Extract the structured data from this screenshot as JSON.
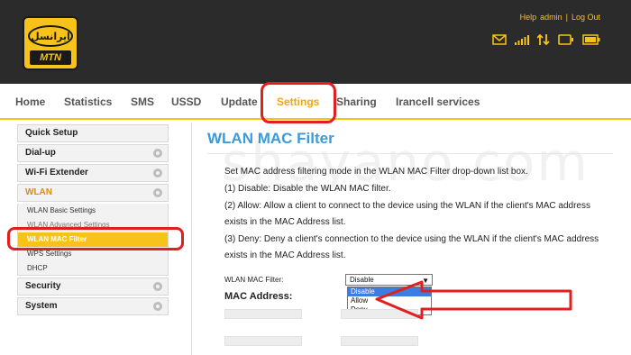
{
  "header": {
    "logo_top": "ایرانسل",
    "logo_bottom": "MTN",
    "links": [
      "Help",
      "admin",
      "|",
      "Log Out"
    ]
  },
  "icons": [
    "mail-icon",
    "signal-icon",
    "transfer-icon",
    "device-icon",
    "battery-icon"
  ],
  "nav": {
    "items": [
      {
        "label": "Home",
        "active": false
      },
      {
        "label": "Statistics",
        "active": false
      },
      {
        "label": "SMS",
        "active": false
      },
      {
        "label": "USSD",
        "active": false
      },
      {
        "label": "Update",
        "active": false
      },
      {
        "label": "Settings",
        "active": true
      },
      {
        "label": "Sharing",
        "active": false
      },
      {
        "label": "Irancell services",
        "active": false
      }
    ]
  },
  "sidebar": {
    "quick_setup": "Quick Setup",
    "dialup": "Dial-up",
    "wifi_extender": "Wi-Fi Extender",
    "wlan": "WLAN",
    "wlan_sub": [
      "WLAN Basic Settings",
      "WLAN Advanced Settings",
      "WLAN MAC Filter",
      "WPS Settings",
      "DHCP"
    ],
    "security": "Security",
    "system": "System"
  },
  "main": {
    "title": "WLAN MAC Filter",
    "desc": [
      "Set MAC address filtering mode in the WLAN MAC Filter drop-down list box.",
      "(1) Disable: Disable the WLAN MAC filter.",
      "(2) Allow: Allow a client to connect to the device using the WLAN if the client's MAC address",
      "exists in the MAC Address list.",
      "(3) Deny: Deny a client's connection to the device using the WLAN if the client's MAC address",
      "exists in the MAC Address list."
    ],
    "filter_label": "WLAN MAC Filter:",
    "filter_value": "Disable",
    "options": [
      "Disable",
      "Allow",
      "Deny"
    ],
    "mac_label": "MAC Address:"
  },
  "watermark": "shayano.com",
  "colors": {
    "header_bg": "#2b2b2b",
    "brand_yellow": "#f7c21a",
    "active_orange": "#f5a40b",
    "title_blue": "#3b9ad9",
    "annotation_red": "#e0201f"
  }
}
